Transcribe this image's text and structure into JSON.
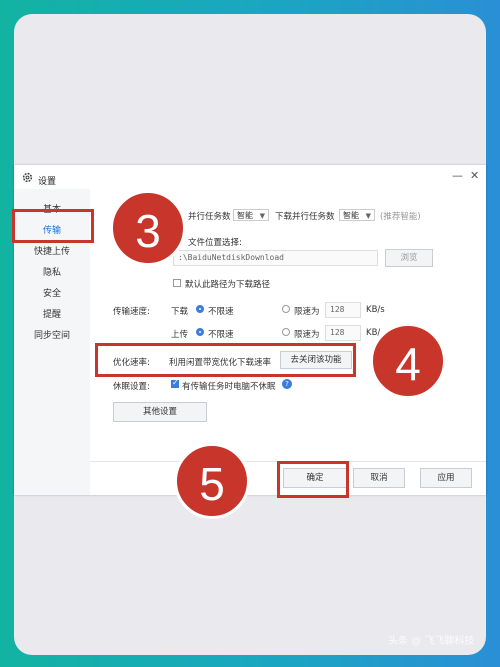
{
  "dialog": {
    "title": "设置",
    "minimize_icon": "—",
    "close_icon": "✕"
  },
  "sidebar": {
    "items": [
      {
        "label": "基本"
      },
      {
        "label": "传输"
      },
      {
        "label": "快捷上传"
      },
      {
        "label": "隐私"
      },
      {
        "label": "安全"
      },
      {
        "label": "提醒"
      },
      {
        "label": "同步空间"
      }
    ],
    "active": "传输"
  },
  "transfer": {
    "upload_tasks_label": "并行任务数",
    "upload_tasks_value": "智能",
    "download_tasks_label": "下载并行任务数",
    "download_tasks_value": "智能",
    "recommend": "(推荐智能)",
    "location_label": "文件位置选择:",
    "path_value": ":\\BaiduNetdiskDownload",
    "browse_button": "浏览",
    "default_path_label": "默认此路径为下载路径",
    "speed_label": "传输速度:",
    "download_label": "下载",
    "upload_label": "上传",
    "unlimited": "不限速",
    "limit_to": "限速为",
    "download_limit": "128",
    "upload_limit": "128",
    "unit": "KB/s",
    "unit_cut": "KB/",
    "optimize_label": "优化速率:",
    "optimize_text": "利用闲置带宽优化下载速率",
    "optimize_button": "去关闭该功能",
    "sleep_label": "休眠设置:",
    "sleep_text": "有传输任务时电脑不休眠",
    "help_icon": "?",
    "other_settings": "其他设置"
  },
  "footer": {
    "ok": "确定",
    "cancel": "取消",
    "apply": "应用"
  },
  "callouts": {
    "step3": "3",
    "step4": "4",
    "step5": "5"
  },
  "watermark": "头条 @ 飞飞聊科技",
  "colors": {
    "highlight": "#c7352b",
    "accent": "#3b7ddd",
    "background_gradient": [
      "#13b3a2",
      "#2a8fd6"
    ]
  }
}
